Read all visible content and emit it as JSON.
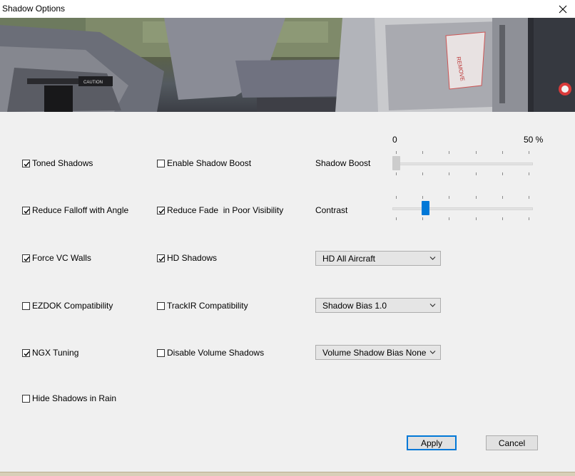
{
  "window": {
    "title": "Shadow Options"
  },
  "icons": {
    "close": "close-icon",
    "check": "checkmark-icon",
    "dropdown": "chevron-down-icon"
  },
  "colors": {
    "accent": "#0078d7",
    "disabled_thumb": "#cccccc"
  },
  "checkboxes": {
    "toned_shadows": {
      "label": "Toned Shadows",
      "checked": true
    },
    "reduce_falloff": {
      "label": "Reduce Falloff with Angle",
      "checked": true
    },
    "force_vc_walls": {
      "label": "Force VC Walls",
      "checked": true
    },
    "ezdok": {
      "label": "EZDOK Compatibility",
      "checked": false
    },
    "ngx_tuning": {
      "label": "NGX Tuning",
      "checked": true
    },
    "hide_rain": {
      "label": "Hide Shadows in Rain",
      "checked": false
    },
    "enable_boost": {
      "label": "Enable Shadow Boost",
      "checked": false
    },
    "reduce_fade": {
      "label": "Reduce Fade  in Poor Visibility",
      "checked": true
    },
    "hd_shadows": {
      "label": "HD Shadows",
      "checked": true
    },
    "trackir": {
      "label": "TrackIR Compatibility",
      "checked": false
    },
    "disable_volume": {
      "label": "Disable Volume Shadows",
      "checked": false
    }
  },
  "sliders": {
    "scale_min": "0",
    "scale_max": "50 %",
    "shadow_boost": {
      "label": "Shadow Boost",
      "value_fraction": 0.0,
      "enabled": false
    },
    "contrast": {
      "label": "Contrast",
      "value_fraction": 0.22,
      "enabled": true
    }
  },
  "dropdowns": {
    "hd_mode": {
      "selected": "HD All Aircraft"
    },
    "shadow_bias": {
      "selected": "Shadow Bias 1.0"
    },
    "volume_bias": {
      "selected": "Volume Shadow Bias None"
    }
  },
  "buttons": {
    "apply": "Apply",
    "cancel": "Cancel"
  }
}
